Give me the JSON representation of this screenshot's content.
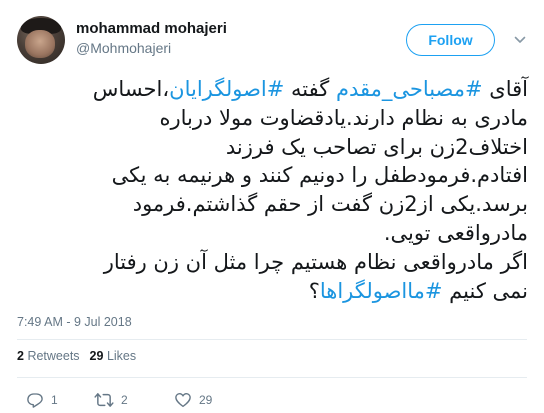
{
  "user": {
    "display_name": "mohammad mohajeri",
    "handle": "@Mohmohajeri"
  },
  "follow_button": {
    "label": "Follow"
  },
  "tweet": {
    "lines": [
      [
        {
          "t": "آقای ",
          "h": false
        },
        {
          "t": "#مصباحی_مقدم",
          "h": true
        },
        {
          "t": " گفته ",
          "h": false
        },
        {
          "t": "#اصولگرایان",
          "h": true
        },
        {
          "t": "،احساس",
          "h": false
        }
      ],
      [
        {
          "t": "مادری به نظام دارند.یادقضاوت مولا درباره",
          "h": false
        }
      ],
      [
        {
          "t": "اختلاف2زن برای تصاحب یک فرزند",
          "h": false
        }
      ],
      [
        {
          "t": "افتادم.فرمودطفل را دونیم کنند و هرنیمه به یکی",
          "h": false
        }
      ],
      [
        {
          "t": "برسد.یکی از2زن گفت از حقم گذاشتم.فرمود",
          "h": false
        }
      ],
      [
        {
          "t": "مادرواقعی تویی.",
          "h": false
        }
      ],
      [
        {
          "t": "اگر مادرواقعی نظام هستیم چرا مثل آن زن رفتار",
          "h": false
        }
      ],
      [
        {
          "t": "نمی کنیم ",
          "h": false
        },
        {
          "t": "#مااصولگراها",
          "h": true
        },
        {
          "t": "؟",
          "h": false
        }
      ]
    ],
    "timestamp": "7:49 AM - 9 Jul 2018"
  },
  "stats": {
    "retweets_count": "2",
    "retweets_label": "Retweets",
    "likes_count": "29",
    "likes_label": "Likes"
  },
  "actions": {
    "reply_count": "1",
    "retweet_count": "2",
    "like_count": "29"
  },
  "colors": {
    "accent": "#1da1f2",
    "hashtag": "#1b95e0",
    "muted": "#657786",
    "text": "#14171a",
    "divider": "#e6ecf0"
  },
  "icons": [
    "avatar",
    "chevron-down-icon",
    "reply-icon",
    "retweet-icon",
    "heart-icon"
  ]
}
